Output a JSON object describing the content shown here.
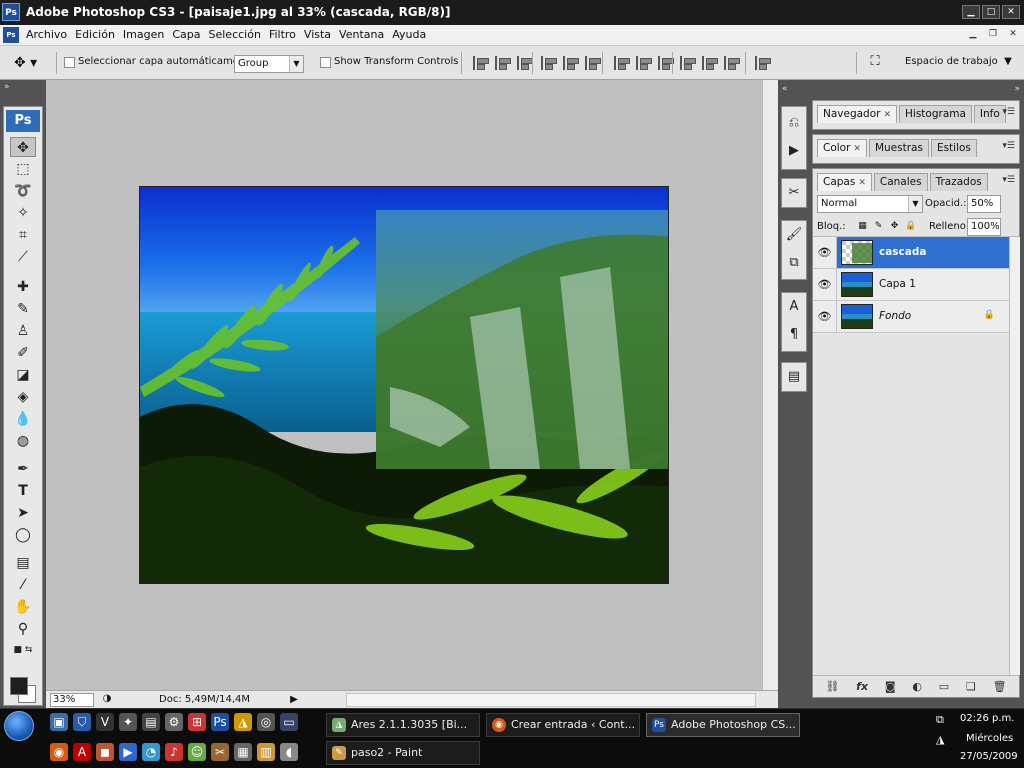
{
  "window": {
    "title": "Adobe Photoshop CS3 - [paisaje1.jpg al 33% (cascada, RGB/8)]",
    "app_badge": "Ps"
  },
  "menu": {
    "doc_badge": "Ps",
    "items": [
      "Archivo",
      "Edición",
      "Imagen",
      "Capa",
      "Selección",
      "Filtro",
      "Vista",
      "Ventana",
      "Ayuda"
    ]
  },
  "options": {
    "auto_select_label": "Seleccionar capa automáticamente",
    "auto_select_value": "Group",
    "transform_label": "Show Transform Controls",
    "workspace_label": "Espacio de trabajo"
  },
  "toolbox": {
    "logo": "Ps",
    "tools": [
      "move-tool",
      "marquee-tool",
      "lasso-tool",
      "magic-wand-tool",
      "crop-tool",
      "slice-tool",
      "healing-brush-tool",
      "brush-tool",
      "clone-stamp-tool",
      "history-brush-tool",
      "eraser-tool",
      "paint-bucket-tool",
      "blur-tool",
      "dodge-tool",
      "pen-tool",
      "type-tool",
      "path-selection-tool",
      "shape-tool",
      "notes-tool",
      "eyedropper-tool",
      "hand-tool",
      "zoom-tool"
    ],
    "fg_color": "#1e1e1e",
    "bg_color": "#ffffff"
  },
  "status": {
    "zoom": "33%",
    "doc_info": "Doc: 5,49M/14,4M"
  },
  "panels": {
    "group1": [
      "Navegador",
      "Histograma",
      "Info"
    ],
    "group2": [
      "Color",
      "Muestras",
      "Estilos"
    ],
    "group3": [
      "Capas",
      "Canales",
      "Trazados"
    ],
    "blend_mode": "Normal",
    "opacity_label": "Opacid.:",
    "opacity_value": "50%",
    "lock_label": "Bloq.:",
    "fill_label": "Relleno:",
    "fill_value": "100%",
    "layers": [
      {
        "name": "cascada",
        "selected": true,
        "italic": false,
        "locked": false
      },
      {
        "name": "Capa 1",
        "selected": false,
        "italic": false,
        "locked": false
      },
      {
        "name": "Fondo",
        "selected": false,
        "italic": true,
        "locked": true
      }
    ]
  },
  "taskbar": {
    "tasks": [
      {
        "label": "Ares 2.1.1.3035 [Bi...",
        "active": false
      },
      {
        "label": "Crear entrada ‹ Cont...",
        "active": false
      },
      {
        "label": "Adobe Photoshop CS...",
        "active": true
      },
      {
        "label": "paso2 - Paint",
        "active": false
      }
    ],
    "time": "02:26 p.m.",
    "day": "Miércoles",
    "date": "27/05/2009"
  },
  "colors": {
    "selection": "#2e6fd0",
    "accent": "#1e4e9c"
  }
}
